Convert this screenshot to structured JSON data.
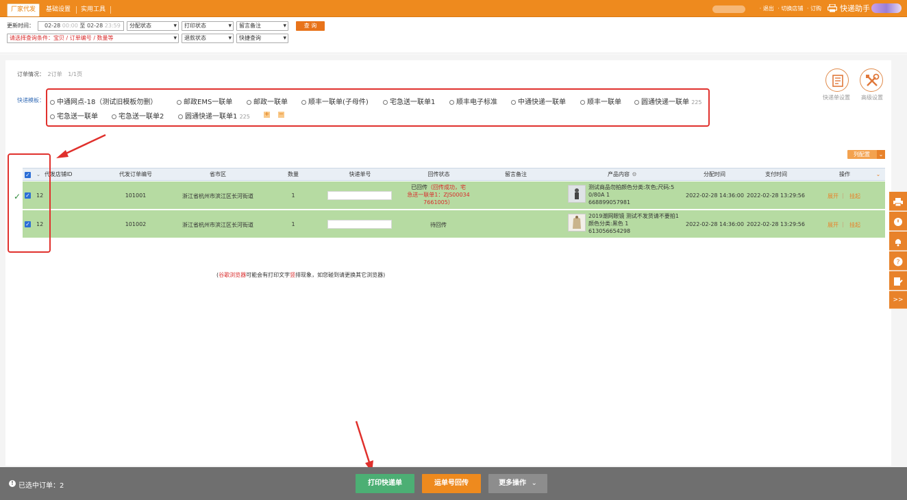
{
  "topbar": {
    "tabs": [
      {
        "label": "厂家代发",
        "active": true
      },
      {
        "label": "基础设置",
        "active": false
      },
      {
        "label": "实用工具",
        "active": false
      }
    ],
    "right_links": [
      "· 退出",
      "· 切换店铺",
      "· 订购"
    ],
    "brand": "快递助手"
  },
  "filter": {
    "update_time_label": "更新时间：",
    "start_date": "02-28",
    "start_time": "00:00",
    "to": "至",
    "end_date": "02-28",
    "end_time": "23:59",
    "dist_status": "分配状态",
    "print_status": "打印状态",
    "note": "留言备注",
    "query_btn": "查 询",
    "search_cond": "请选择查询条件：宝贝 / 订单编号 / 数量等",
    "refund_status": "退款状态",
    "quick_query": "快捷查询"
  },
  "order_info": {
    "label": "订单情况：",
    "count": "2订单",
    "pages": "1/1页"
  },
  "template": {
    "label": "快递模板：",
    "options_row1": [
      "中通网点-18（测试旧模板勿删）",
      "邮政EMS一联单",
      "邮政一联单",
      "顺丰一联单(子母件)",
      "宅急送一联单1",
      "顺丰电子标准",
      "中通快递一联单",
      "顺丰一联单",
      "圆通快递一联单"
    ],
    "row1_tail": "225",
    "options_row2": [
      "宅急送一联单",
      "宅急送一联单2",
      "圆通快递一联单1"
    ],
    "row2_tail": "225",
    "add": "+",
    "remove": "−"
  },
  "tools": {
    "waybill_settings": "快递单设置",
    "advanced_settings": "高级设置"
  },
  "column_config": "列配置",
  "table": {
    "headers": {
      "shop_id": "代发店铺ID",
      "order_no": "代发订单编号",
      "region": "省市区",
      "qty": "数量",
      "tracking": "快递单号",
      "reply_status": "回传状态",
      "note": "留言备注",
      "product": "产品内容",
      "dist_time": "分配时间",
      "pay_time": "支付时间",
      "action": "操作"
    },
    "rows": [
      {
        "shop_id": "12",
        "order_no": "101001",
        "region": "浙江省杭州市滨江区长河街道",
        "qty": "1",
        "reply_main": "已回传",
        "reply_detail_1": "（回传成功，宅",
        "reply_detail_2": "急送一联单1：ZJS00034",
        "reply_detail_3": "7661005）",
        "product_line1": "测试商品勿拍颜色分类:灰色;尺码:5",
        "product_line2": "0/80A 1",
        "product_line3": "668899057981",
        "dist_time": "2022-02-28 14:36:00",
        "pay_time": "2022-02-28 13:29:56",
        "op_expand": "展开",
        "op_hold": "挂起"
      },
      {
        "shop_id": "12",
        "order_no": "101002",
        "region": "浙江省杭州市滨江区长河街道",
        "qty": "1",
        "reply_main": "待回传",
        "product_line1": "2019潮网眼镜 测试不发货请不要拍1",
        "product_line2": "颜色分类:黑色 1",
        "product_line3": "613056654298",
        "dist_time": "2022-02-28 14:36:00",
        "pay_time": "2022-02-28 13:29:56",
        "op_expand": "展开",
        "op_hold": "挂起"
      }
    ]
  },
  "browser_note": {
    "p1": "(",
    "p2": "谷歌浏览器",
    "p3": "可能会有打印文字",
    "p4": "竖",
    "p5": "排现象，如您碰到请更换其它浏览器)"
  },
  "side_buttons": {
    "more": ">>"
  },
  "bottom": {
    "selected": "已选中订单：2",
    "print_btn": "打印快递单",
    "reply_btn": "运单号回传",
    "more_btn": "更多操作"
  },
  "colors": {
    "orange": "#ee8a1e",
    "row_green": "#b6dba2",
    "print_green": "#4caf74",
    "reply_orange": "#ee8a1e",
    "annotation_red": "#e0302c"
  }
}
